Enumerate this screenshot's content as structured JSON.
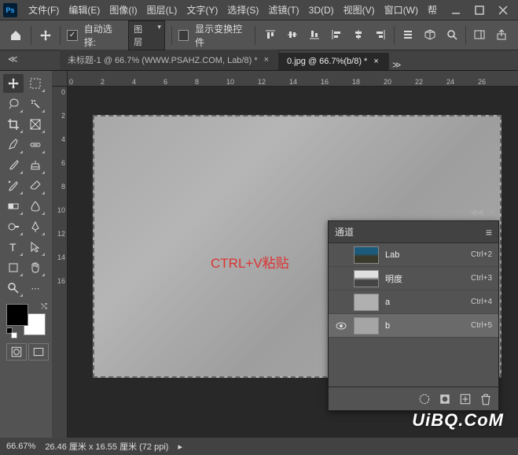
{
  "app": {
    "logo": "Ps"
  },
  "menu": [
    "文件(F)",
    "编辑(E)",
    "图像(I)",
    "图层(L)",
    "文字(Y)",
    "选择(S)",
    "滤镜(T)",
    "3D(D)",
    "视图(V)",
    "窗口(W)",
    "帮"
  ],
  "options": {
    "auto_select": "自动选择:",
    "select_target": "图层",
    "show_transform": "显示变换控件"
  },
  "tabs": [
    {
      "label": "未标题-1 @ 66.7% (WWW.PSAHZ.COM, Lab/8) *",
      "active": false
    },
    {
      "label": "0.jpg @ 66.7%(b/8) *",
      "active": true
    }
  ],
  "ruler_h": [
    "0",
    "2",
    "4",
    "6",
    "8",
    "10",
    "12",
    "14",
    "16",
    "18",
    "20",
    "22",
    "24",
    "26"
  ],
  "ruler_v": [
    "0",
    "2",
    "4",
    "6",
    "8",
    "10",
    "12",
    "14",
    "16"
  ],
  "canvas_text": "CTRL+V粘贴",
  "channels": {
    "title": "通道",
    "items": [
      {
        "name": "Lab",
        "shortcut": "Ctrl+2",
        "visible": false,
        "thumb": "linear-gradient(180deg,#1b5a7a 40%,#3a3a2a 60%)"
      },
      {
        "name": "明度",
        "shortcut": "Ctrl+3",
        "visible": false,
        "thumb": "linear-gradient(180deg,#e0e0e0 40%,#444 60%)"
      },
      {
        "name": "a",
        "shortcut": "Ctrl+4",
        "visible": false,
        "thumb": "#b0b0b0"
      },
      {
        "name": "b",
        "shortcut": "Ctrl+5",
        "visible": true,
        "thumb": "#a5a5a5",
        "selected": true
      }
    ]
  },
  "status": {
    "zoom": "66.67%",
    "doc_info": "26.46 厘米 x 16.55 厘米 (72 ppi)"
  },
  "watermark": "UiBQ.CoM"
}
